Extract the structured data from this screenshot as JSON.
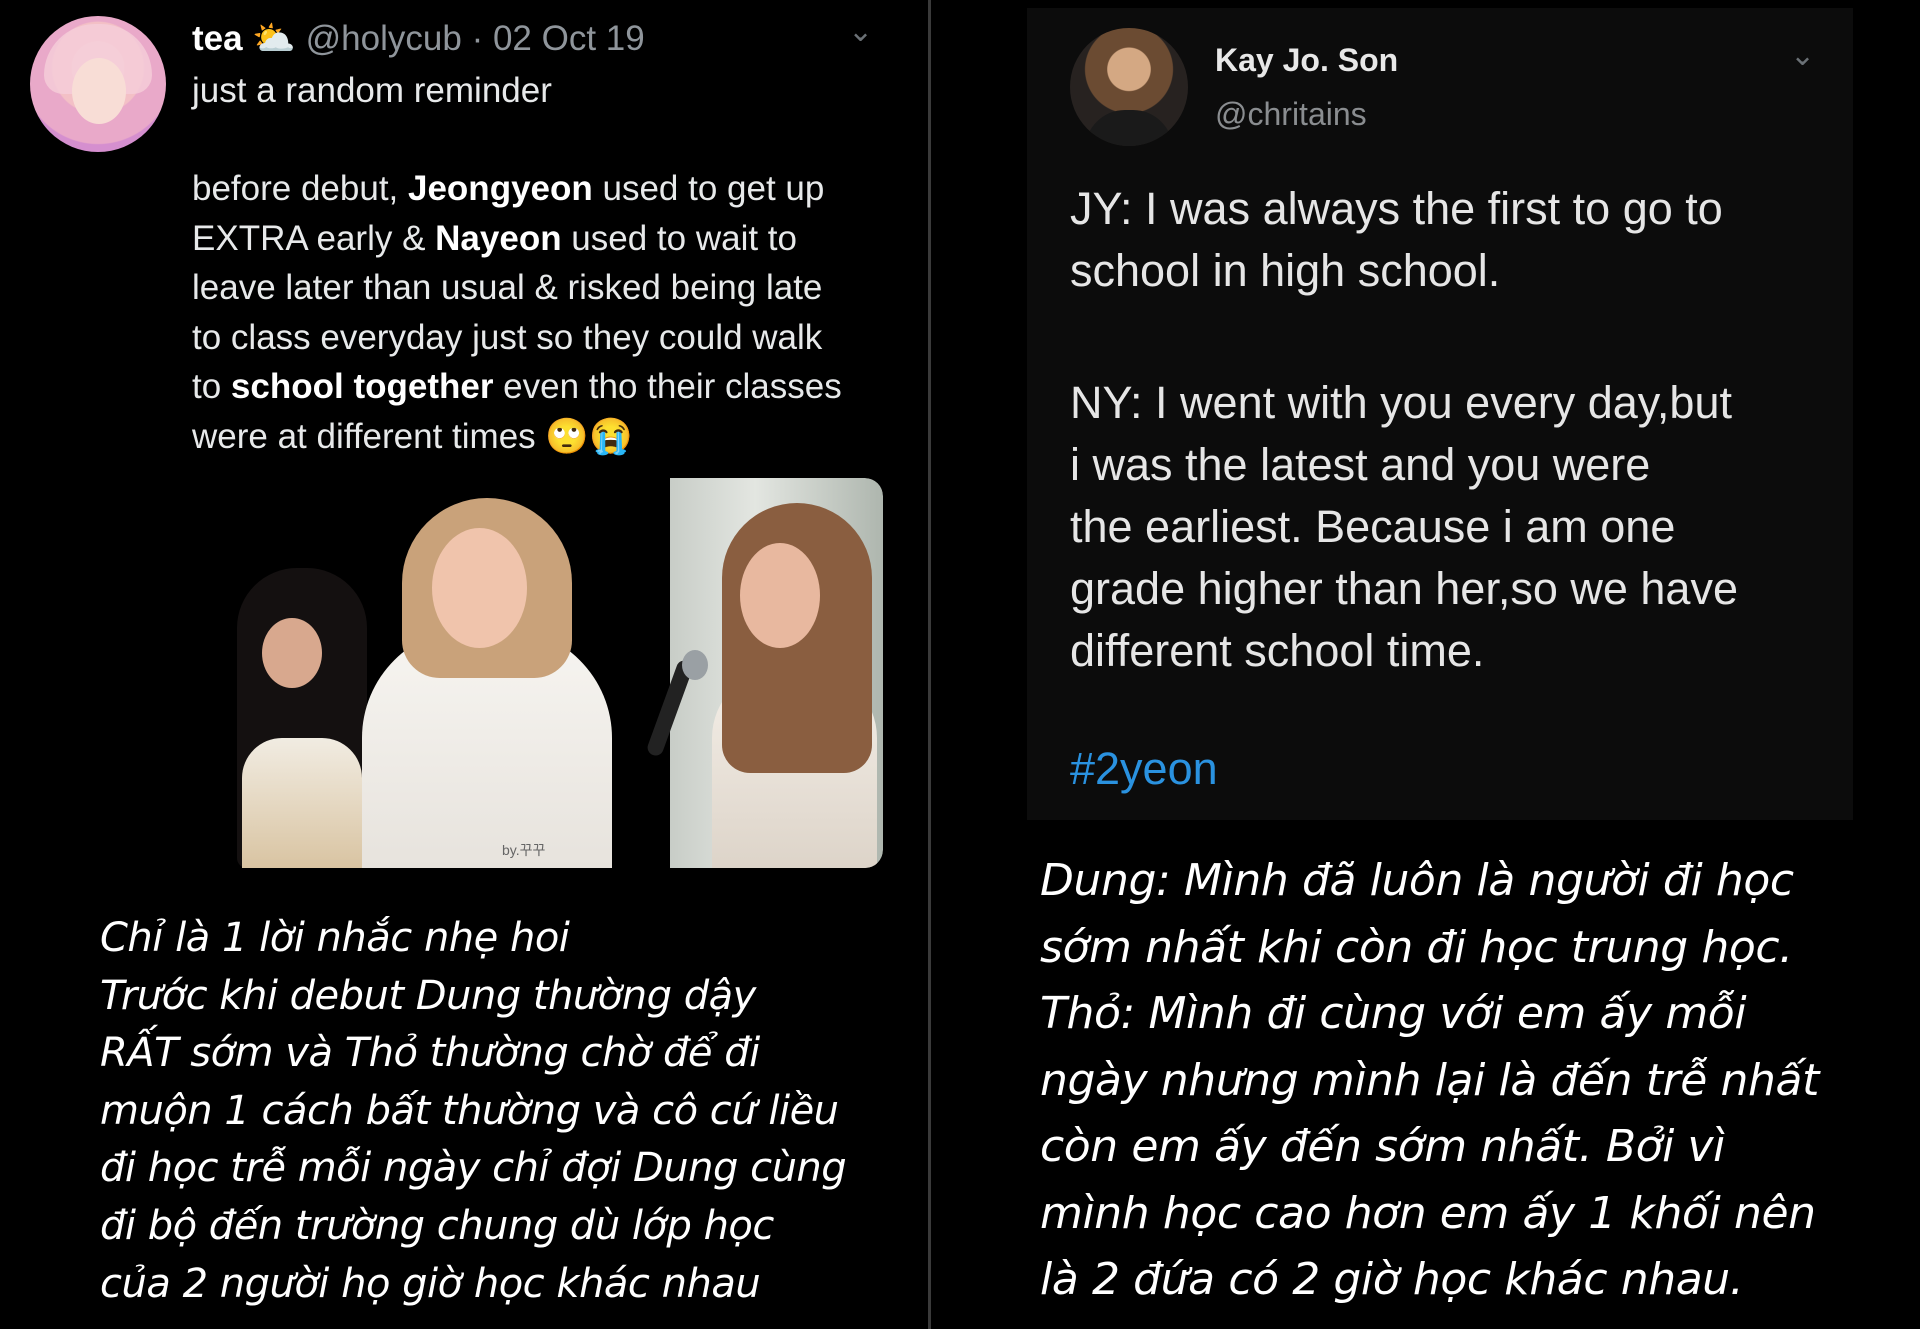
{
  "left_tweet": {
    "display_name": "tea",
    "name_emoji": "⛅",
    "handle": "@holycub",
    "separator": "·",
    "date": "02 Oct 19",
    "line1": "just a random reminder",
    "body": [
      [
        "before debut, ",
        "Jeongyeon",
        " used to get up"
      ],
      [
        "EXTRA early & ",
        "Nayeon",
        " used to wait to"
      ],
      [
        "leave later than usual & risked being late",
        "",
        ""
      ],
      [
        "to class everyday just so they could walk",
        "",
        ""
      ],
      [
        "to ",
        "school together",
        " even tho their classes"
      ],
      [
        "were at different times ",
        "",
        ""
      ]
    ],
    "body_emojis": "🙄😭",
    "photo_watermark": "by.꾸꾸"
  },
  "left_caption": [
    "Chỉ là 1 lời nhắc nhẹ hoi",
    "Trước khi debut Dung thường dậy",
    "RẤT sớm và Thỏ thường chờ để đi",
    "muộn 1 cách bất thường và cô cứ liều",
    "đi học trễ mỗi ngày chỉ đợi Dung cùng",
    "đi bộ đến trường chung dù lớp học",
    "của 2 người họ giờ học khác nhau"
  ],
  "right_tweet": {
    "display_name": "Kay Jo. Son",
    "handle": "@chritains",
    "body": [
      "JY: I was always the first to go to",
      "school in high school.",
      "",
      "NY: I went with you every day,but",
      "i was the latest and you were",
      "the earliest. Because i am one",
      "grade higher than her,so we have",
      "different school time."
    ],
    "hashtag": "#2yeon"
  },
  "right_caption": [
    "Dung: Mình đã luôn là người đi học",
    "sớm nhất khi còn đi học trung học.",
    "Thỏ: Mình đi cùng với em ấy mỗi",
    "ngày nhưng mình lại là đến trễ nhất",
    "còn em ấy đến sớm nhất. Bởi vì",
    "mình học cao hơn em ấy 1 khối nên",
    "là 2 đứa có 2 giờ học khác nhau."
  ],
  "icons": {
    "chevron": "⌄"
  },
  "colors": {
    "background": "#000000",
    "handle_gray": "#8f959b",
    "hashtag_blue": "#2a92e0"
  }
}
